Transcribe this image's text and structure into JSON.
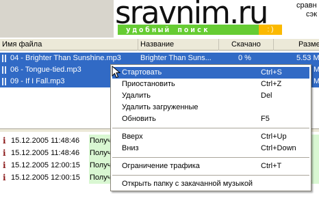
{
  "banner": {
    "logo": "sravnim.ru",
    "tagline": "удобный поиск",
    "tagline_suffix": ": )",
    "side_line1": "сравн",
    "side_line2": "сэк"
  },
  "columns": [
    "Имя файла",
    "Название",
    "Скачано",
    "Разме"
  ],
  "files": [
    {
      "name": "04 - Brighter Than Sunshine.mp3",
      "title": "Brighter Than Suns...",
      "downloaded": "0 %",
      "size": "5.53 M",
      "selected": true
    },
    {
      "name": "06 - Tongue-tied.mp3",
      "title": "",
      "downloaded": "",
      "size": "M",
      "selected": true
    },
    {
      "name": "09 - If I Fall.mp3",
      "title": "",
      "downloaded": "",
      "size": "M",
      "selected": true
    }
  ],
  "log": [
    {
      "time": "15.12.2005 11:48:46",
      "msg": "Получ"
    },
    {
      "time": "15.12.2005 11:48:46",
      "msg": "Получ"
    },
    {
      "time": "15.12.2005 12:00:15",
      "msg": "Получ"
    },
    {
      "time": "15.12.2005 12:00:15",
      "msg": "Получ"
    }
  ],
  "menu": {
    "start": {
      "label": "Стартовать",
      "shortcut": "Ctrl+S"
    },
    "pause": {
      "label": "Приостановить",
      "shortcut": "Ctrl+Z"
    },
    "delete": {
      "label": "Удалить",
      "shortcut": "Del"
    },
    "delete_downloaded": {
      "label": "Удалить загруженные",
      "shortcut": ""
    },
    "refresh": {
      "label": "Обновить",
      "shortcut": "F5"
    },
    "up": {
      "label": "Вверх",
      "shortcut": "Ctrl+Up"
    },
    "down": {
      "label": "Вниз",
      "shortcut": "Ctrl+Down"
    },
    "traffic_limit": {
      "label": "Ограничение трафика",
      "shortcut": "Ctrl+T"
    },
    "open_folder": {
      "label": "Открыть папку с закачанной музыкой",
      "shortcut": ""
    }
  },
  "colors": {
    "selection": "#316ac5",
    "tagline_green": "#66cc33",
    "tagline_orange": "#fbb900",
    "log_green": "#d9f7d2"
  }
}
